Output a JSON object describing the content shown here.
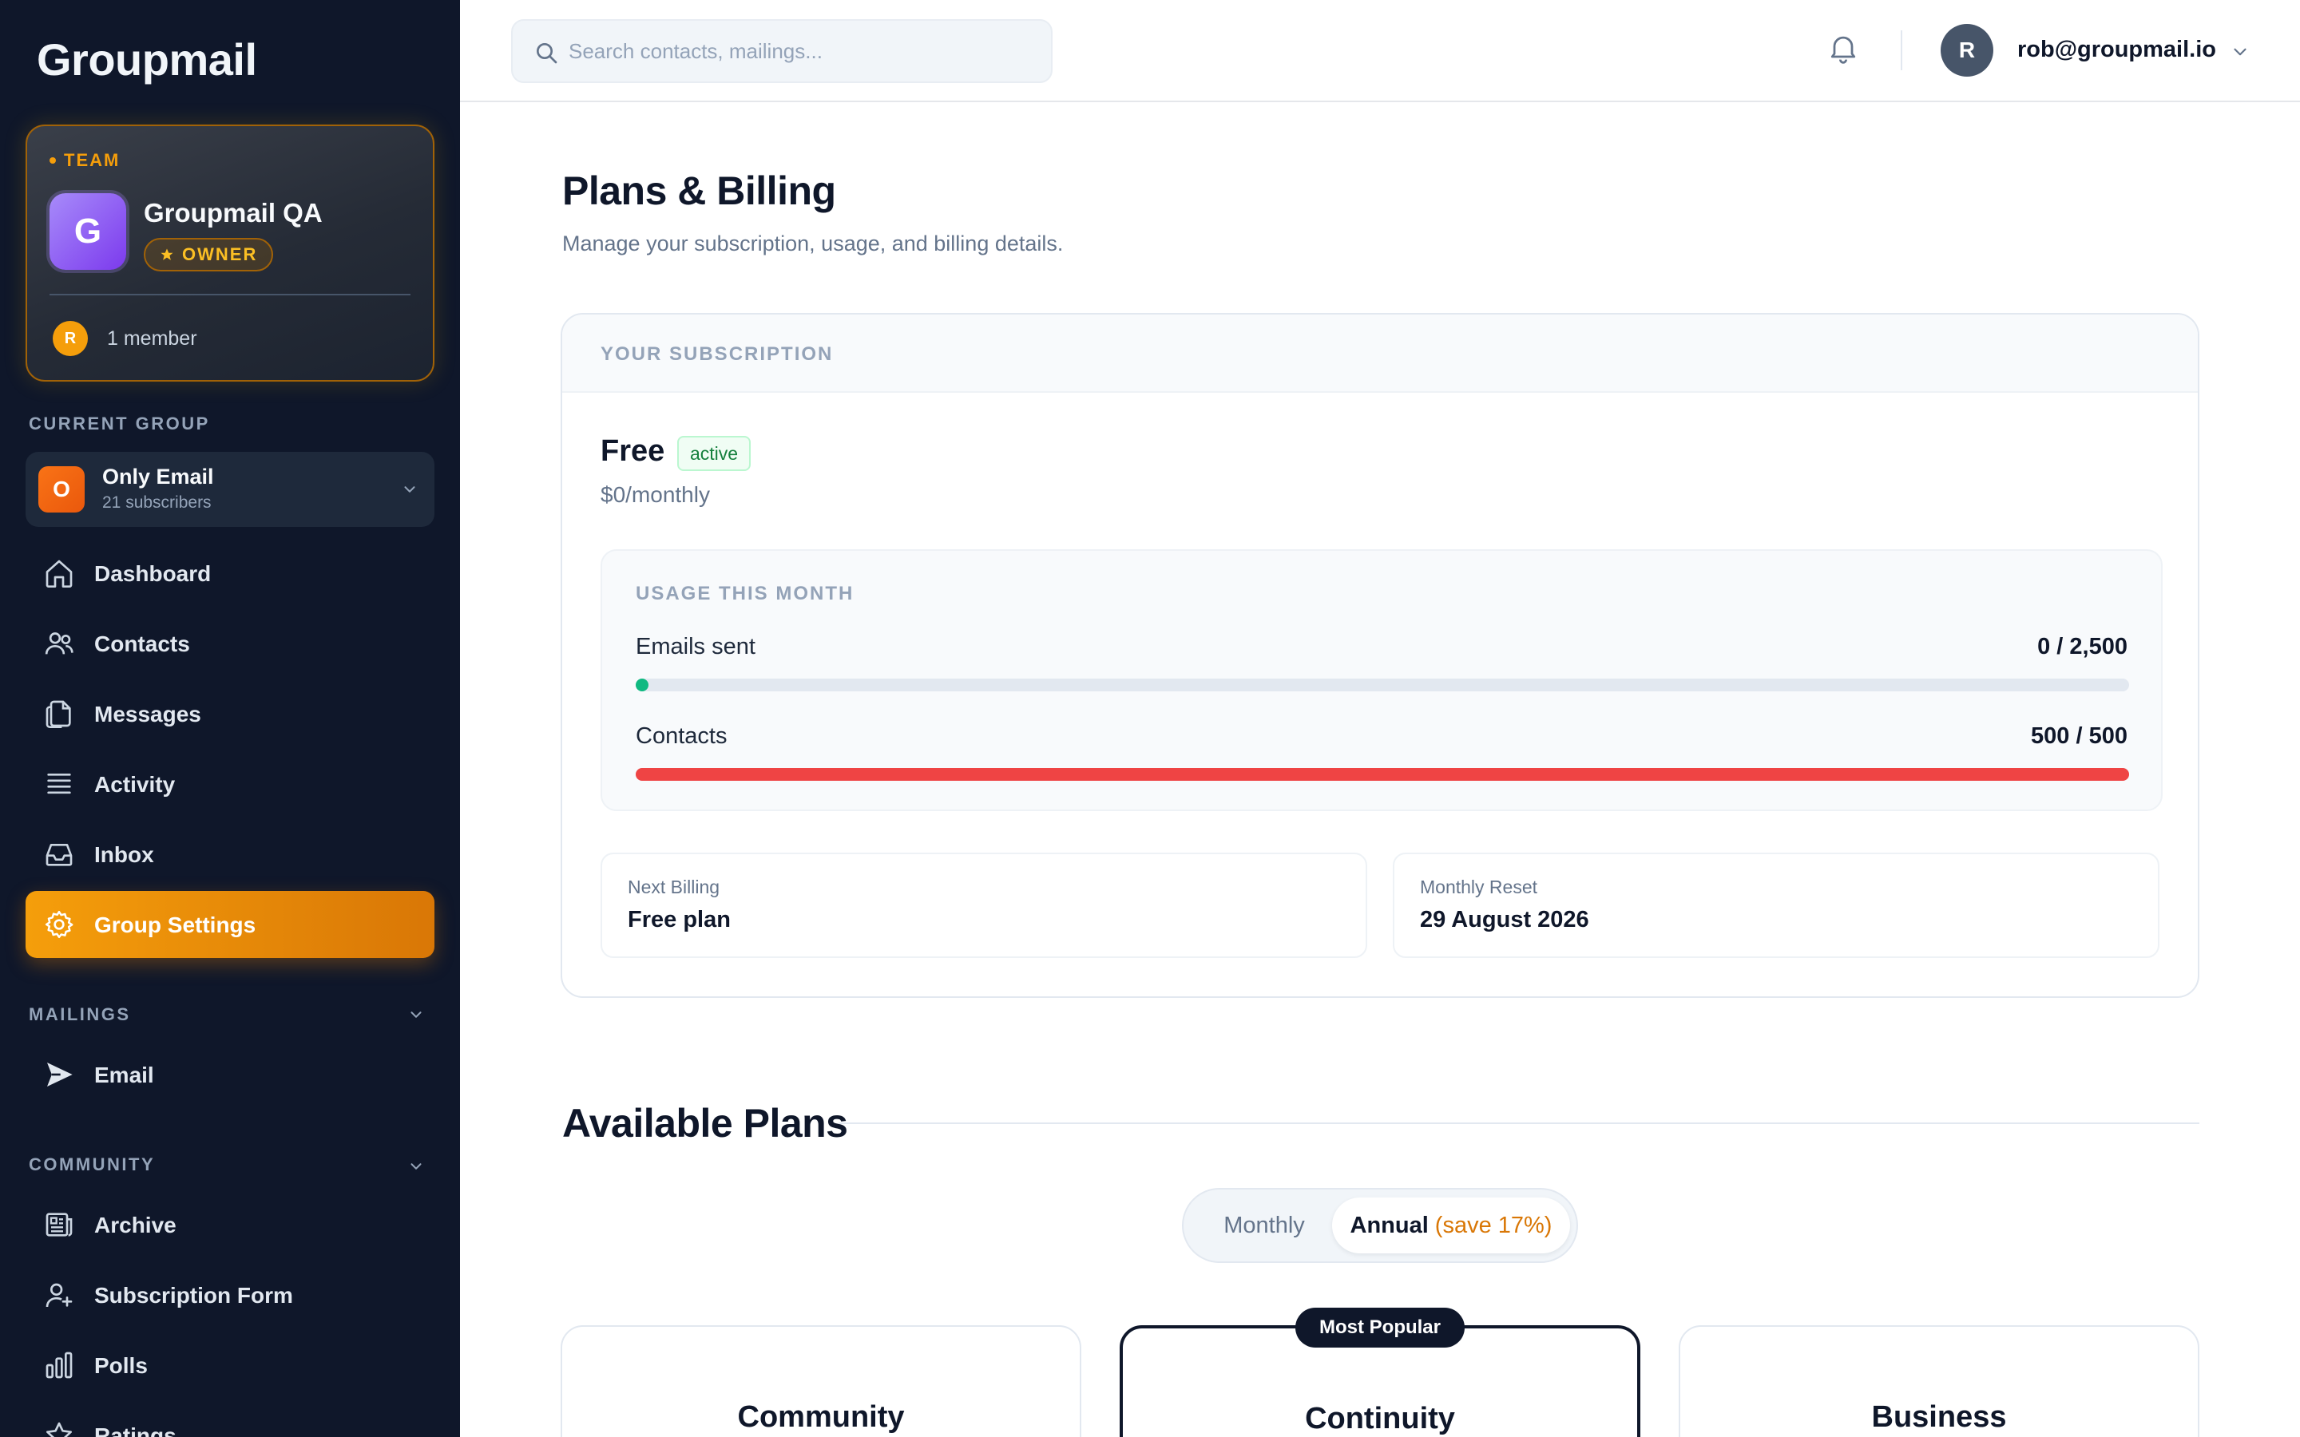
{
  "app": {
    "name": "Groupmail"
  },
  "team": {
    "tag": "TEAM",
    "avatar_letter": "G",
    "name": "Groupmail QA",
    "role": "OWNER",
    "member_avatar": "R",
    "member_count": "1 member"
  },
  "sidebar": {
    "current_group_label": "CURRENT GROUP",
    "group": {
      "icon_letter": "O",
      "name": "Only Email",
      "subscribers": "21 subscribers"
    },
    "nav": [
      {
        "label": "Dashboard",
        "icon": "home-icon"
      },
      {
        "label": "Contacts",
        "icon": "users-icon"
      },
      {
        "label": "Messages",
        "icon": "documents-icon"
      },
      {
        "label": "Activity",
        "icon": "list-icon"
      },
      {
        "label": "Inbox",
        "icon": "inbox-icon"
      },
      {
        "label": "Group Settings",
        "icon": "gear-icon",
        "active": true
      }
    ],
    "mailings_label": "MAILINGS",
    "mailings": [
      {
        "label": "Email",
        "icon": "send-icon"
      }
    ],
    "community_label": "COMMUNITY",
    "community": [
      {
        "label": "Archive",
        "icon": "newspaper-icon"
      },
      {
        "label": "Subscription Form",
        "icon": "user-plus-icon"
      },
      {
        "label": "Polls",
        "icon": "bar-chart-icon"
      },
      {
        "label": "Ratings",
        "icon": "star-icon"
      }
    ]
  },
  "topbar": {
    "search_placeholder": "Search contacts, mailings...",
    "user_avatar": "R",
    "user_email": "rob@groupmail.io"
  },
  "page": {
    "title": "Plans & Billing",
    "subtitle": "Manage your subscription, usage, and billing details."
  },
  "subscription": {
    "header": "YOUR SUBSCRIPTION",
    "plan": "Free",
    "status": "active",
    "price": "$0/monthly",
    "usage": {
      "title": "USAGE THIS MONTH",
      "emails": {
        "label": "Emails sent",
        "value": "0 / 2,500",
        "fraction": 0.0,
        "color": "#10b981"
      },
      "contacts": {
        "label": "Contacts",
        "value": "500 / 500",
        "fraction": 1.0,
        "color": "#ef4444"
      }
    },
    "next_billing": {
      "label": "Next Billing",
      "value": "Free plan"
    },
    "monthly_reset": {
      "label": "Monthly Reset",
      "value": "29 August 2026"
    }
  },
  "plans": {
    "title": "Available Plans",
    "toggle": {
      "monthly": "Monthly",
      "annual": "Annual",
      "annual_save": "(save 17%)",
      "selected": "annual"
    },
    "popular_badge": "Most Popular",
    "cards": [
      {
        "name": "Community"
      },
      {
        "name": "Continuity"
      },
      {
        "name": "Business"
      }
    ]
  },
  "colors": {
    "accent": "#f59e0b",
    "sidebar_bg": "#0f172a",
    "danger": "#ef4444",
    "success": "#10b981"
  }
}
